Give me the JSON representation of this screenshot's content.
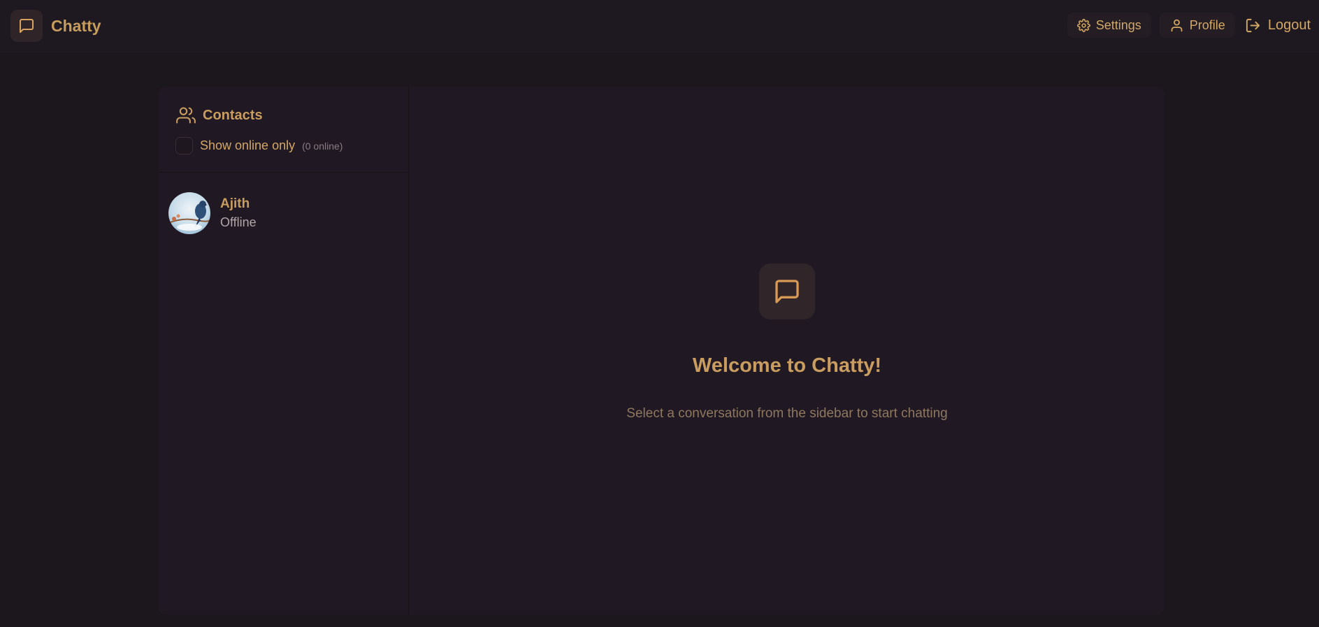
{
  "app": {
    "name": "Chatty",
    "accent": "#c99d5f"
  },
  "nav": {
    "settings_label": "Settings",
    "profile_label": "Profile",
    "logout_label": "Logout"
  },
  "sidebar": {
    "title": "Contacts",
    "filter_label": "Show online only",
    "online_count": "(0 online)",
    "contacts": [
      {
        "name": "Ajith",
        "status": "Offline"
      }
    ]
  },
  "welcome": {
    "title": "Welcome to Chatty!",
    "subtitle": "Select a conversation from the sidebar to start chatting"
  },
  "icons": {
    "brand": "message-square-icon",
    "settings": "gear-icon",
    "profile": "user-icon",
    "logout": "logout-icon",
    "contacts": "users-icon",
    "welcome": "message-square-icon"
  }
}
